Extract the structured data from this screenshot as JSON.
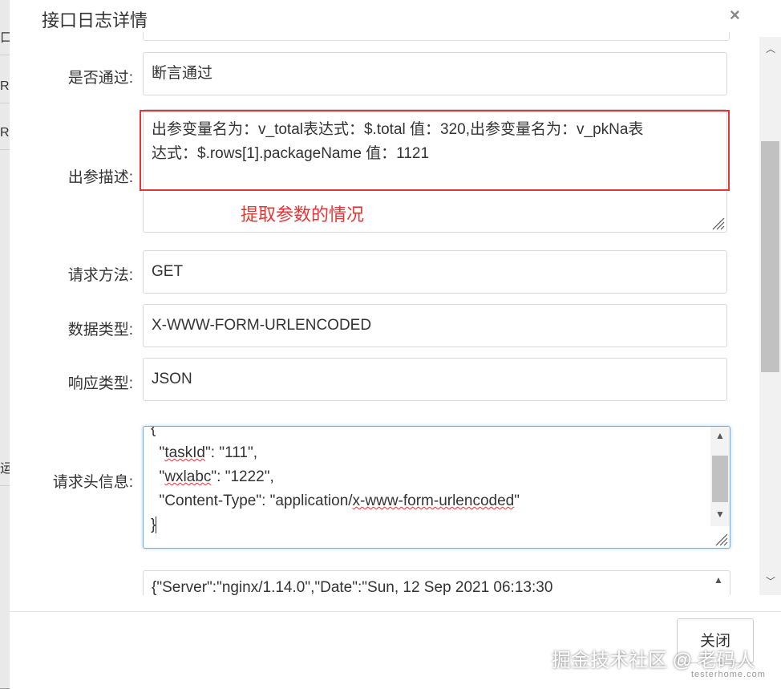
{
  "background": {
    "rows": [
      "口",
      "R",
      "R",
      "运"
    ]
  },
  "dialog": {
    "title": "接口日志详情",
    "close_icon": "close-icon"
  },
  "fields": {
    "pass": {
      "label": "是否通过:",
      "value": "断言通过"
    },
    "out_desc": {
      "label": "出参描述:",
      "line1": "出参变量名为：v_total表达式：$.total 值：320,出参变量名为：v_pkNa表",
      "line2": "达式：$.rows[1].packageName 值：1121"
    },
    "annotation": "提取参数的情况",
    "method": {
      "label": "请求方法:",
      "value": "GET"
    },
    "data_type": {
      "label": "数据类型:",
      "value": "X-WWW-FORM-URLENCODED"
    },
    "resp_type": {
      "label": "响应类型:",
      "value": "JSON"
    },
    "headers": {
      "label": "请求头信息:",
      "l1": "{",
      "l2a": "  \"",
      "l2b": "taskId",
      "l2c": "\": \"111\",",
      "l3a": "  \"",
      "l3b": "wxlabc",
      "l3c": "\": \"1222\",",
      "l4a": "  \"Content-Type\": \"application/",
      "l4b": "x-www-form-urlencoded",
      "l4c": "\"",
      "l5": "}"
    },
    "response": {
      "value": "{\"Server\":\"nginx/1.14.0\",\"Date\":\"Sun, 12 Sep 2021 06:13:30"
    }
  },
  "footer": {
    "close_label": "关闭"
  },
  "watermark": {
    "text": "掘金技术社区 @ 老码人",
    "sub": "testerhome.com"
  },
  "colors": {
    "annotation_red": "#e53535",
    "focus_blue": "#66afe9"
  }
}
